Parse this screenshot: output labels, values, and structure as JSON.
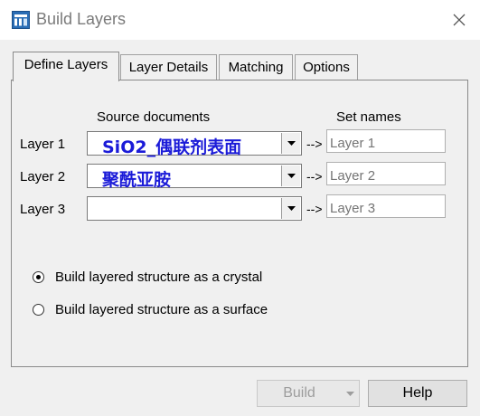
{
  "window": {
    "title": "Build Layers"
  },
  "tabs": [
    {
      "label": "Define Layers",
      "active": true
    },
    {
      "label": "Layer Details",
      "active": false
    },
    {
      "label": "Matching",
      "active": false
    },
    {
      "label": "Options",
      "active": false
    }
  ],
  "columns": {
    "source": "Source documents",
    "names": "Set names"
  },
  "layers": [
    {
      "label": "Layer 1",
      "source": "SiO2_偶联剂表面",
      "arrow": "-->",
      "set_name_placeholder": "Layer 1"
    },
    {
      "label": "Layer 2",
      "source": "聚酰亚胺",
      "arrow": "-->",
      "set_name_placeholder": "Layer 2"
    },
    {
      "label": "Layer 3",
      "source": "",
      "arrow": "-->",
      "set_name_placeholder": "Layer 3"
    }
  ],
  "options": [
    {
      "label": "Build layered structure as a crystal",
      "checked": true
    },
    {
      "label": "Build layered structure as a surface",
      "checked": false
    }
  ],
  "buttons": {
    "build": "Build",
    "help": "Help"
  },
  "colors": {
    "source_text": "#1b1bd8",
    "placeholder": "#9a9a9a"
  }
}
